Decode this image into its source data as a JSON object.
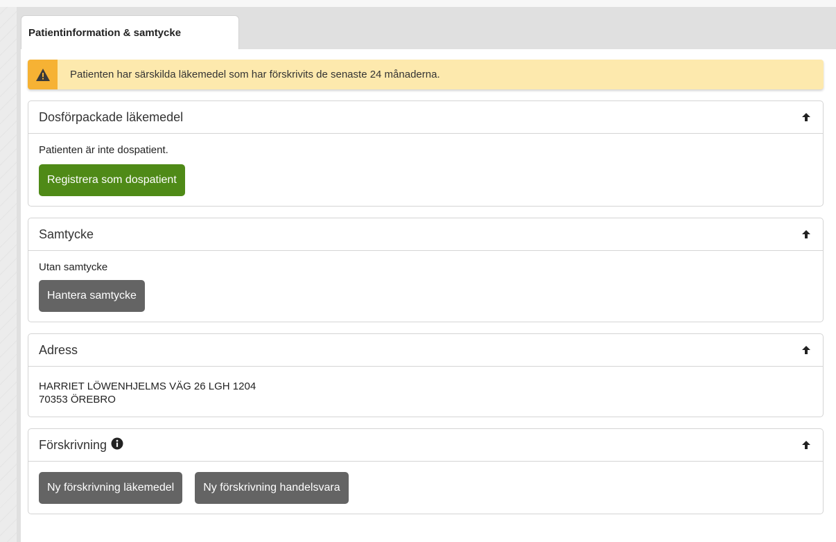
{
  "tab": {
    "label": "Patientinformation & samtycke"
  },
  "alert": {
    "text": "Patienten har särskilda läkemedel som har förskrivits de senaste 24 månaderna.",
    "icon": "warning-icon"
  },
  "dos": {
    "title": "Dosförpackade läkemedel",
    "status": "Patienten är inte dospatient.",
    "button": "Registrera som dospatient"
  },
  "consent": {
    "title": "Samtycke",
    "status": "Utan samtycke",
    "button": "Hantera samtycke"
  },
  "address": {
    "title": "Adress",
    "line1": "HARRIET LÖWENHJELMS VÄG 26 LGH 1204",
    "line2": "70353 ÖREBRO"
  },
  "prescription": {
    "title": "Förskrivning",
    "button_drug": "Ny förskrivning läkemedel",
    "button_goods": "Ny förskrivning handelsvara"
  },
  "colors": {
    "alert_bg": "#fde9ad",
    "alert_icon_bg": "#f6b234",
    "primary_green": "#4f8a17",
    "button_gray": "#646464"
  }
}
